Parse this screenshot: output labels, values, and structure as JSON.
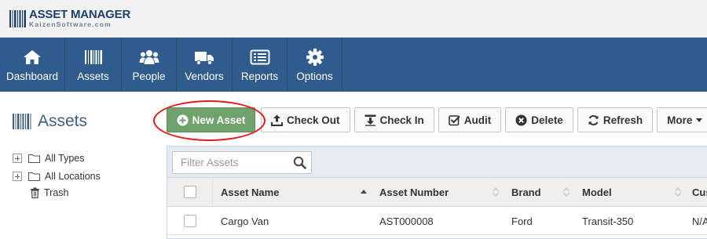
{
  "app": {
    "title": "ASSET MANAGER",
    "subtitle": "KaizenSoftware.com"
  },
  "nav": {
    "items": [
      {
        "label": "Dashboard",
        "icon": "home-icon"
      },
      {
        "label": "Assets",
        "icon": "barcode-icon"
      },
      {
        "label": "People",
        "icon": "users-icon"
      },
      {
        "label": "Vendors",
        "icon": "truck-icon"
      },
      {
        "label": "Reports",
        "icon": "list-icon"
      },
      {
        "label": "Options",
        "icon": "gear-icon"
      }
    ],
    "active": "Assets",
    "bar_color": "#2f5b8d"
  },
  "sidebar": {
    "title": "Assets",
    "tree": [
      {
        "label": "All Types",
        "icon": "folder-icon",
        "expandable": true
      },
      {
        "label": "All Locations",
        "icon": "folder-icon",
        "expandable": true
      },
      {
        "label": "Trash",
        "icon": "trash-icon",
        "expandable": false
      }
    ]
  },
  "toolbar": {
    "new_asset": "New Asset",
    "check_out": "Check Out",
    "check_in": "Check In",
    "audit": "Audit",
    "delete": "Delete",
    "refresh": "Refresh",
    "more": "More",
    "primary_color": "#6fa26c",
    "highlight_color": "#e01b1b"
  },
  "grid": {
    "filter_placeholder": "Filter Assets",
    "columns": [
      "Asset Name",
      "Asset Number",
      "Brand",
      "Model",
      "Cus"
    ],
    "sorted_column": "Asset Name",
    "rows": [
      {
        "name": "Cargo Van",
        "number": "AST000008",
        "brand": "Ford",
        "model": "Transit-350",
        "custom": "N/A"
      }
    ]
  }
}
